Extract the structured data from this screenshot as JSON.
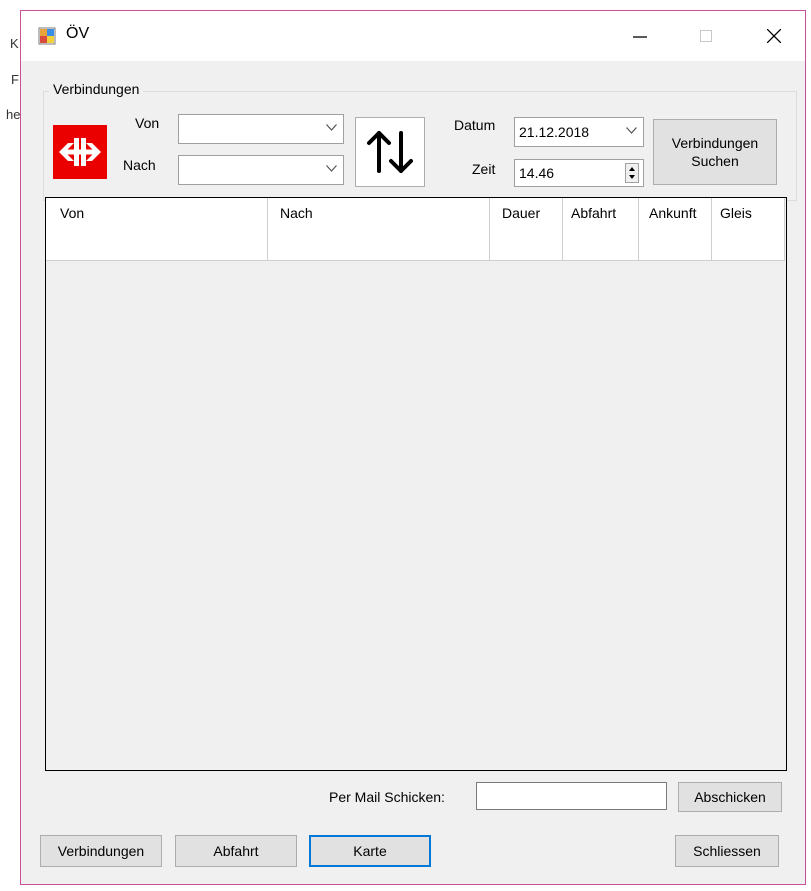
{
  "background_fragments": [
    "K",
    "F",
    "he"
  ],
  "window": {
    "title": "ÖV",
    "controls": {
      "minimize": "minimize",
      "maximize": "maximize",
      "close": "close"
    }
  },
  "connections_group": {
    "title": "Verbindungen",
    "from_label": "Von",
    "to_label": "Nach",
    "from_value": "",
    "to_value": "",
    "date_label": "Datum",
    "date_value": "21.12.2018",
    "time_label": "Zeit",
    "time_value": "14.46",
    "search_button": "Verbindungen\nSuchen"
  },
  "table": {
    "columns": [
      "Von",
      "Nach",
      "Dauer",
      "Abfahrt",
      "Ankunft",
      "Gleis"
    ],
    "rows": [
      [
        "",
        "",
        "",
        "",
        "",
        ""
      ]
    ]
  },
  "mail": {
    "label": "Per Mail Schicken:",
    "value": "",
    "send_button": "Abschicken"
  },
  "bottom_buttons": {
    "connections": "Verbindungen",
    "departure": "Abfahrt",
    "map": "Karte",
    "close": "Schliessen"
  },
  "colors": {
    "accent_border": "#c7509a",
    "sbb_red": "#eb0000",
    "focus_blue": "#0078d7",
    "window_bg": "#f0f0f0"
  },
  "icons": {
    "app": "app-window-icon",
    "logo": "sbb-logo-icon",
    "swap": "swap-arrows-icon",
    "dropdown": "chevron-down-icon"
  }
}
